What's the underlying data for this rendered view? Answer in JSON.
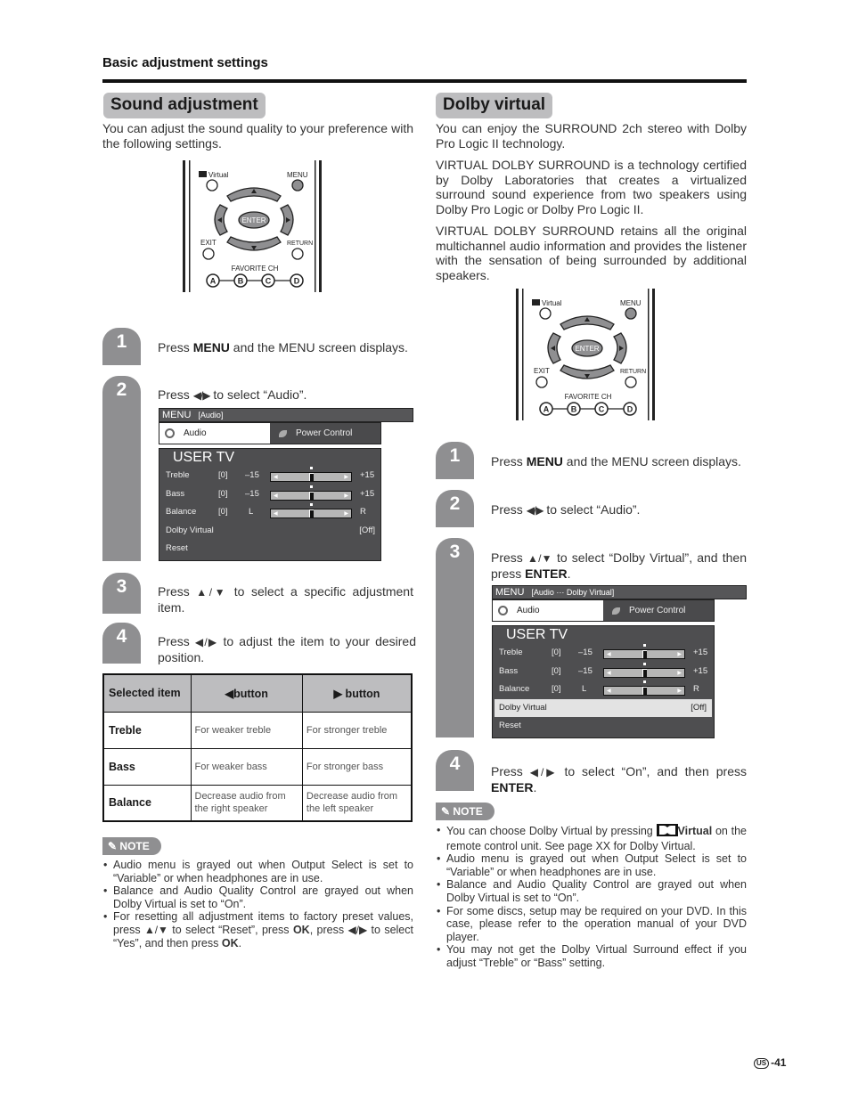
{
  "header": {
    "section": "Basic adjustment settings"
  },
  "sound_adjustment": {
    "title": "Sound adjustment",
    "intro": "You can adjust the sound quality to your preference with the following settings.",
    "steps": [
      {
        "num": "1",
        "pre": "Press ",
        "bold": "MENU",
        "post": " and the MENU screen displays."
      },
      {
        "num": "2",
        "pre": "Press ",
        "arrows": "◀/▶",
        "post": " to select “Audio”."
      },
      {
        "num": "3",
        "pre": "Press ",
        "arrows": "▲/▼",
        "post": " to select a specific adjustment item."
      },
      {
        "num": "4",
        "pre": "Press ",
        "arrows": "◀/▶",
        "post": " to adjust the item to your desired position."
      }
    ],
    "table": {
      "headers": [
        "Selected item",
        "◀button",
        "▶ button"
      ],
      "rows": [
        {
          "item": "Treble",
          "left": "For weaker treble",
          "right": "For stronger treble"
        },
        {
          "item": "Bass",
          "left": "For weaker bass",
          "right": "For stronger bass"
        },
        {
          "item": "Balance",
          "left": "Decrease audio from the right speaker",
          "right": "Decrease audio from the left speaker"
        }
      ]
    },
    "note_label": "NOTE",
    "notes": [
      "Audio menu is grayed out when Output Select is set to “Variable” or when headphones are in use.",
      "Balance and Audio Quality Control are grayed out when Dolby Virtual is set to “On”."
    ],
    "note3": {
      "a": "For resetting all adjustment items to factory preset values, press ",
      "arrows1": "▲/▼",
      "b": " to select “Reset”, press ",
      "ok1": "OK",
      "c": ", press ",
      "arrows2": "◀/▶",
      "d": " to select “Yes”, and then press ",
      "ok2": "OK",
      "e": "."
    }
  },
  "remote": {
    "virtual_label": "Virtual",
    "menu_label": "MENU",
    "enter_label": "ENTER",
    "exit_label": "EXIT",
    "return_label": "RETURN",
    "favorite_label": "FAVORITE CH",
    "fav_buttons": [
      "A",
      "B",
      "C",
      "D"
    ]
  },
  "osd_left": {
    "menu_label": "MENU",
    "crumb": "[Audio]",
    "tab_audio": "Audio",
    "tab_power": "Power Control",
    "panel_title": "USER TV",
    "rows": [
      {
        "label": "Treble",
        "value": "[0]",
        "min": "–15",
        "max": "+15",
        "level": 0.5
      },
      {
        "label": "Bass",
        "value": "[0]",
        "min": "–15",
        "max": "+15",
        "level": 0.5
      },
      {
        "label": "Balance",
        "value": "[0]",
        "min": "L",
        "max": "R",
        "level": 0.5
      }
    ],
    "dolby_label": "Dolby Virtual",
    "dolby_value": "[Off]",
    "reset_label": "Reset"
  },
  "osd_right": {
    "menu_label": "MENU",
    "crumb": "[Audio ··· Dolby Virtual]",
    "tab_audio": "Audio",
    "tab_power": "Power Control",
    "panel_title": "USER TV",
    "rows": [
      {
        "label": "Treble",
        "value": "[0]",
        "min": "–15",
        "max": "+15",
        "level": 0.5
      },
      {
        "label": "Bass",
        "value": "[0]",
        "min": "–15",
        "max": "+15",
        "level": 0.5
      },
      {
        "label": "Balance",
        "value": "[0]",
        "min": "L",
        "max": "R",
        "level": 0.5
      }
    ],
    "dolby_label": "Dolby Virtual",
    "dolby_value": "[Off]",
    "reset_label": "Reset"
  },
  "dolby_virtual": {
    "title": "Dolby virtual",
    "paragraphs": [
      "You can enjoy the SURROUND 2ch stereo with Dolby Pro Logic II technology.",
      "VIRTUAL DOLBY SURROUND is a technology certified by Dolby Laboratories that creates a virtualized surround sound experience from two speakers using Dolby Pro Logic or Dolby Pro Logic II.",
      "VIRTUAL DOLBY SURROUND retains all the original multichannel audio information and provides the listener with the sensation of being surrounded by additional speakers."
    ],
    "steps": [
      {
        "num": "1",
        "pre": "Press ",
        "bold": "MENU",
        "post": " and the MENU screen displays."
      },
      {
        "num": "2",
        "pre": "Press ",
        "arrows": "◀/▶",
        "post": " to select “Audio”."
      },
      {
        "num": "3",
        "pre": "Press ",
        "arrows": "▲/▼",
        "post": " to select “Dolby Virtual”, and then press ",
        "bold_end": "ENTER",
        "end": "."
      },
      {
        "num": "4",
        "pre": "Press ",
        "arrows": "◀/▶",
        "post": " to select “On”, and then press ",
        "bold_end": "ENTER",
        "end": "."
      }
    ],
    "note_label": "NOTE",
    "note1": {
      "a": "You can choose Dolby Virtual by pressing ",
      "bold": "Virtual",
      "b": " on the remote control unit. See page XX for Dolby Virtual."
    },
    "notes": [
      "Audio menu is grayed out when Output Select is set to “Variable” or when headphones are in use.",
      "Balance and Audio Quality Control are grayed out when Dolby Virtual is set to “On”.",
      "For some discs, setup may be required on your DVD. In this case, please refer to the operation manual of your DVD player.",
      "You may not get the Dolby Virtual Surround effect if you adjust “Treble” or “Bass” setting."
    ]
  },
  "footer": {
    "region": "US",
    "page": "-41"
  }
}
